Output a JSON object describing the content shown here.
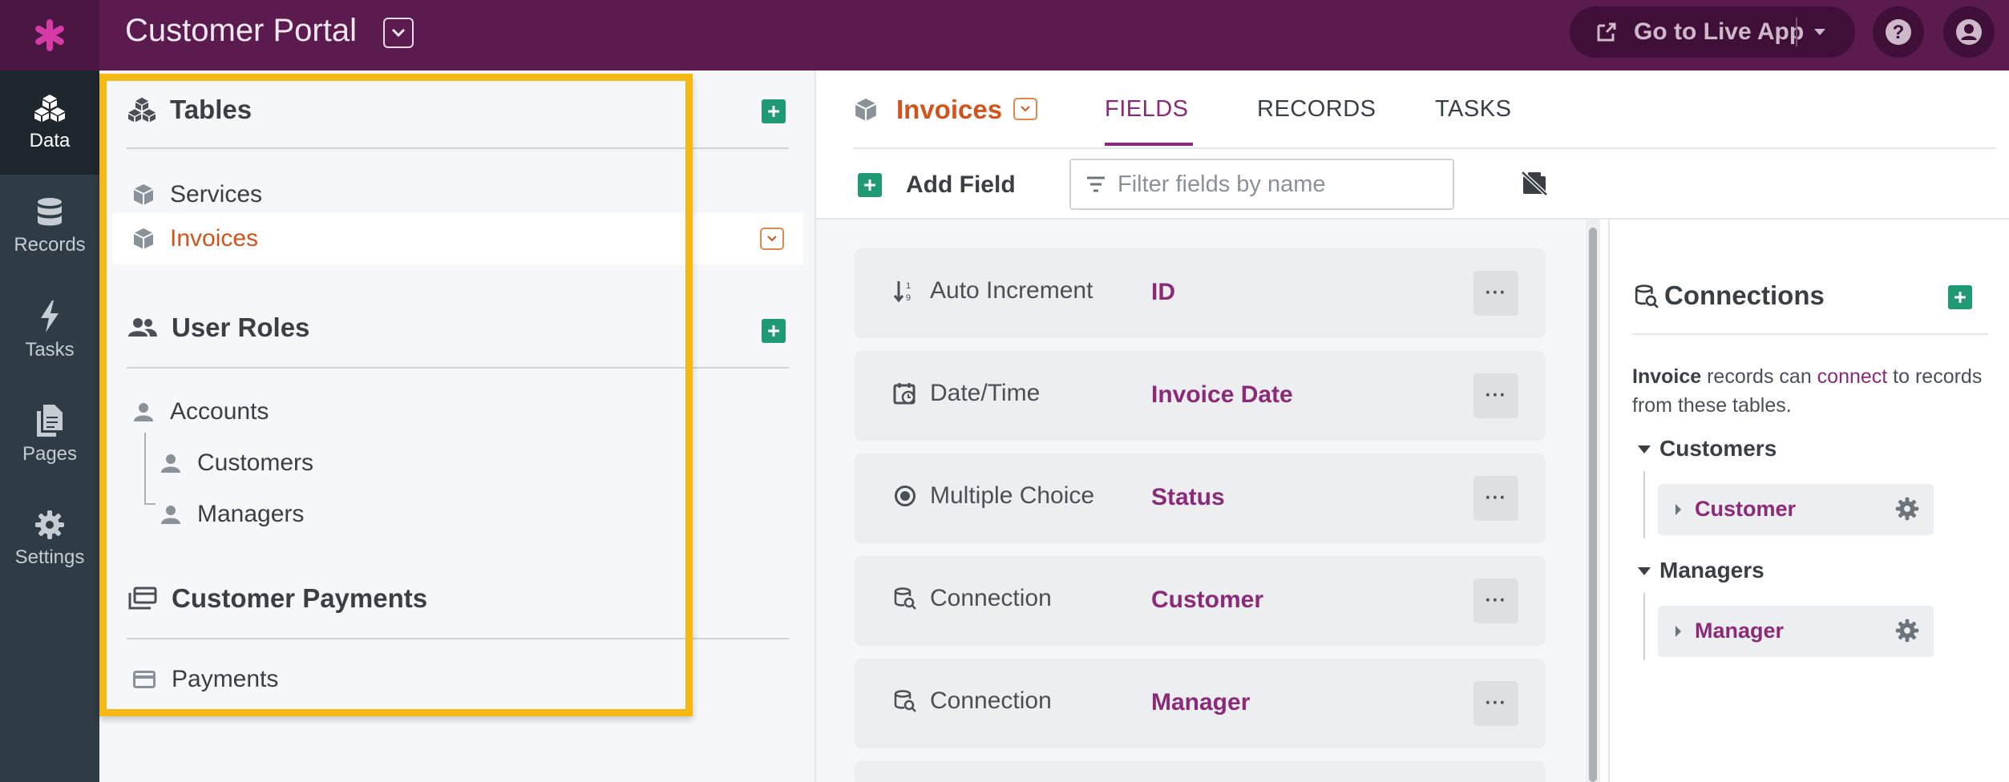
{
  "app": {
    "title": "Customer Portal"
  },
  "topbar": {
    "live_label": "Go to Live App"
  },
  "nav": [
    {
      "label": "Data",
      "icon": "data-icon",
      "active": true
    },
    {
      "label": "Records",
      "icon": "database-icon"
    },
    {
      "label": "Tasks",
      "icon": "bolt-icon"
    },
    {
      "label": "Pages",
      "icon": "pages-icon"
    },
    {
      "label": "Settings",
      "icon": "gear-icon"
    }
  ],
  "tables_panel": {
    "tables_title": "Tables",
    "tables": [
      "Services",
      "Invoices"
    ],
    "selected_table": "Invoices",
    "roles_title": "User Roles",
    "roles": {
      "parent": "Accounts",
      "children": [
        "Customers",
        "Managers"
      ]
    },
    "payments_title": "Customer Payments",
    "payments": [
      "Payments"
    ]
  },
  "main": {
    "table_name": "Invoices",
    "tabs": [
      "FIELDS",
      "RECORDS",
      "TASKS"
    ],
    "active_tab": "FIELDS",
    "add_field_label": "Add Field",
    "filter_placeholder": "Filter fields by name",
    "fields": [
      {
        "type": "Auto Increment",
        "name": "ID",
        "icon": "sort-numeric-icon"
      },
      {
        "type": "Date/Time",
        "name": "Invoice Date",
        "icon": "calendar-clock-icon"
      },
      {
        "type": "Multiple Choice",
        "name": "Status",
        "icon": "radio-icon"
      },
      {
        "type": "Connection",
        "name": "Customer",
        "icon": "connection-icon"
      },
      {
        "type": "Connection",
        "name": "Manager",
        "icon": "connection-icon"
      }
    ],
    "more_label": "···"
  },
  "connections": {
    "title": "Connections",
    "desc_strong": "Invoice",
    "desc_part1": " records can ",
    "desc_link": "connect",
    "desc_part2": " to records from these tables.",
    "groups": [
      {
        "name": "Customers",
        "item": "Customer"
      },
      {
        "name": "Managers",
        "item": "Manager"
      }
    ]
  },
  "colors": {
    "brand_purple": "#5b1b4f",
    "accent_orange": "#d2541c",
    "add_green": "#1f9a74",
    "highlight_yellow": "#f5b915",
    "field_name_purple": "#8c2a7a"
  }
}
